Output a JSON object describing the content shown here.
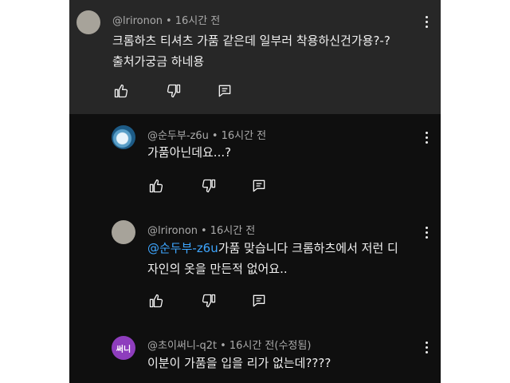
{
  "comments": [
    {
      "handle": "@lrironon",
      "time": "16시간 전",
      "line1": "크롬하츠 티셔츠 가품 같은데 일부러 착용하신건가용?-?",
      "line2": "출처가궁금 하네용",
      "avatar": "gray-circle",
      "highlighted": true
    },
    {
      "handle": "@순두부-z6u",
      "time": "16시간 전",
      "line1": "가품아닌데요...?",
      "avatar": "sea-creature"
    },
    {
      "handle": "@lrironon",
      "time": "16시간 전",
      "mention": "@순두부-z6u",
      "line1_rest": "가품 맞습니다 크롬하츠에서 저런 디",
      "line2": "자인의 옷을 만든적 없어요..",
      "avatar": "gray-circle"
    },
    {
      "handle": "@초이써니-q2t",
      "time": "16시간 전(수정됨)",
      "line1": "이분이 가품을 입을 리가 없는데????",
      "avatar_text": "써니",
      "avatar_color": "#8e3dbd"
    }
  ],
  "separator": "•",
  "icons": [
    "thumbs-up-icon",
    "thumbs-down-icon",
    "reply-icon",
    "more-vert-icon"
  ],
  "colors": {
    "background": "#0f0f0f",
    "highlight": "#272727",
    "mention": "#3ea6ff",
    "meta": "#aaaaaa",
    "text": "#f1f1f1"
  }
}
